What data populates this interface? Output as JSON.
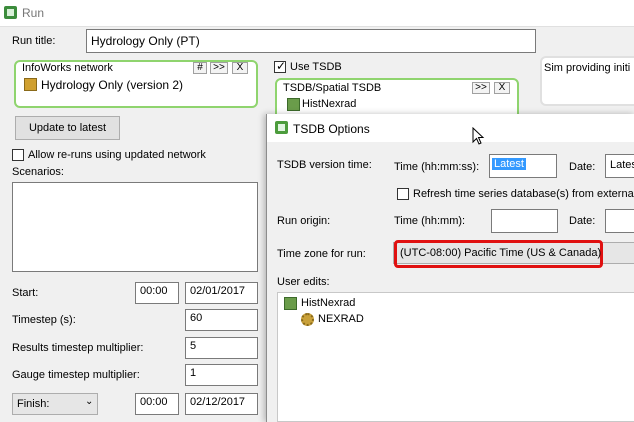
{
  "window": {
    "title": "Run"
  },
  "run_title": {
    "label": "Run title:",
    "value": "Hydrology Only (PT)"
  },
  "infoworks": {
    "title": "InfoWorks network",
    "buttons": [
      "#",
      ">>",
      "X"
    ],
    "item": "Hydrology Only (version 2)"
  },
  "use_tsdb": {
    "label": "Use TSDB",
    "checked": true
  },
  "tsdb": {
    "title": "TSDB/Spatial TSDB",
    "buttons": [
      ">>",
      "X"
    ],
    "item": "HistNexrad"
  },
  "sim_box": {
    "title": "Sim providing initi"
  },
  "update_button": "Update to latest",
  "allow_reruns": {
    "label": "Allow re-runs using updated network",
    "checked": false
  },
  "scenarios_label": "Scenarios:",
  "start": {
    "label": "Start:",
    "time": "00:00",
    "date": "02/01/2017"
  },
  "timestep": {
    "label": "Timestep (s):",
    "value": "60"
  },
  "results_mult": {
    "label": "Results timestep multiplier:",
    "value": "5"
  },
  "gauge_mult": {
    "label": "Gauge timestep multiplier:",
    "value": "1"
  },
  "finish": {
    "select": "Finish:",
    "time": "00:00",
    "date": "02/12/2017"
  },
  "dialog": {
    "title": "TSDB Options",
    "version_time_label": "TSDB version time:",
    "time_hhmmss_label": "Time (hh:mm:ss):",
    "version_time_value": "Latest",
    "date_label": "Date:",
    "date_value": "Lates",
    "refresh_label": "Refresh time series database(s) from external s",
    "run_origin_label": "Run origin:",
    "time_hhmm_label": "Time (hh:mm):",
    "date_label2": "Date:",
    "timezone_label": "Time zone for run:",
    "timezone_value": "(UTC-08:00) Pacific Time (US & Canada)",
    "user_edits_label": "User edits:",
    "tree": [
      {
        "label": "HistNexrad",
        "icon": "database-icon"
      },
      {
        "label": "NEXRAD",
        "icon": "gear-icon"
      }
    ]
  },
  "colors": {
    "green_border": "#8fd46e",
    "highlight": "#e01010",
    "selection": "#3399ff"
  }
}
